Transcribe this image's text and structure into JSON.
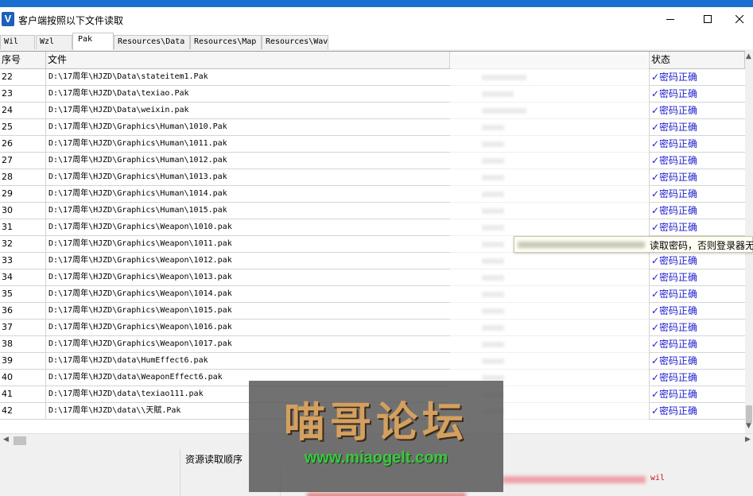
{
  "window": {
    "title": "客户端按照以下文件读取",
    "app_icon": "V"
  },
  "tabs": [
    {
      "label": "Wil"
    },
    {
      "label": "Wzl"
    },
    {
      "label": "Pak"
    },
    {
      "label": "Resources\\Data"
    },
    {
      "label": "Resources\\Map"
    },
    {
      "label": "Resources\\Wav"
    }
  ],
  "active_tab": "Pak",
  "table": {
    "headers": {
      "no": "序号",
      "file": "文件",
      "status": "状态"
    },
    "rows": [
      {
        "no": "22",
        "file": "D:\\17周年\\HJZD\\Data\\stateitem1.Pak",
        "status": "✓密码正确"
      },
      {
        "no": "23",
        "file": "D:\\17周年\\HJZD\\Data\\texiao.Pak",
        "status": "✓密码正确"
      },
      {
        "no": "24",
        "file": "D:\\17周年\\HJZD\\Data\\weixin.pak",
        "status": "✓密码正确"
      },
      {
        "no": "25",
        "file": "D:\\17周年\\HJZD\\Graphics\\Human\\1010.Pak",
        "status": "✓密码正确"
      },
      {
        "no": "26",
        "file": "D:\\17周年\\HJZD\\Graphics\\Human\\1011.pak",
        "status": "✓密码正确"
      },
      {
        "no": "27",
        "file": "D:\\17周年\\HJZD\\Graphics\\Human\\1012.pak",
        "status": "✓密码正确"
      },
      {
        "no": "28",
        "file": "D:\\17周年\\HJZD\\Graphics\\Human\\1013.pak",
        "status": "✓密码正确"
      },
      {
        "no": "29",
        "file": "D:\\17周年\\HJZD\\Graphics\\Human\\1014.pak",
        "status": "✓密码正确"
      },
      {
        "no": "30",
        "file": "D:\\17周年\\HJZD\\Graphics\\Human\\1015.pak",
        "status": "✓密码正确"
      },
      {
        "no": "31",
        "file": "D:\\17周年\\HJZD\\Graphics\\Weapon\\1010.pak",
        "status": "✓密码正确"
      },
      {
        "no": "32",
        "file": "D:\\17周年\\HJZD\\Graphics\\Weapon\\1011.pak",
        "status": ""
      },
      {
        "no": "33",
        "file": "D:\\17周年\\HJZD\\Graphics\\Weapon\\1012.pak",
        "status": "✓密码正确"
      },
      {
        "no": "34",
        "file": "D:\\17周年\\HJZD\\Graphics\\Weapon\\1013.pak",
        "status": "✓密码正确"
      },
      {
        "no": "35",
        "file": "D:\\17周年\\HJZD\\Graphics\\Weapon\\1014.pak",
        "status": "✓密码正确"
      },
      {
        "no": "36",
        "file": "D:\\17周年\\HJZD\\Graphics\\Weapon\\1015.pak",
        "status": "✓密码正确"
      },
      {
        "no": "37",
        "file": "D:\\17周年\\HJZD\\Graphics\\Weapon\\1016.pak",
        "status": "✓密码正确"
      },
      {
        "no": "38",
        "file": "D:\\17周年\\HJZD\\Graphics\\Weapon\\1017.pak",
        "status": "✓密码正确"
      },
      {
        "no": "39",
        "file": "D:\\17周年\\HJZD\\data\\HumEffect6.pak",
        "status": "✓密码正确"
      },
      {
        "no": "40",
        "file": "D:\\17周年\\HJZD\\data\\WeaponEffect6.pak",
        "status": "✓密码正确"
      },
      {
        "no": "41",
        "file": "D:\\17周年\\HJZD\\data\\texiao111.pak",
        "status": "✓密码正确"
      },
      {
        "no": "42",
        "file": "D:\\17周年\\HJZD\\data\\\\天賦.Pak",
        "status": "✓密码正确"
      }
    ]
  },
  "tooltip": {
    "text": "读取密码，否则登录器无法"
  },
  "bottom": {
    "resource_order_label": "资源读取顺序",
    "resource_item": "wil"
  },
  "watermark": {
    "title": "喵哥论坛",
    "url": "www.miaogelt.com"
  },
  "colors": {
    "status_text": "#1c1ccc",
    "title_accent": "#1b6fd0",
    "error_red": "#c81010"
  }
}
